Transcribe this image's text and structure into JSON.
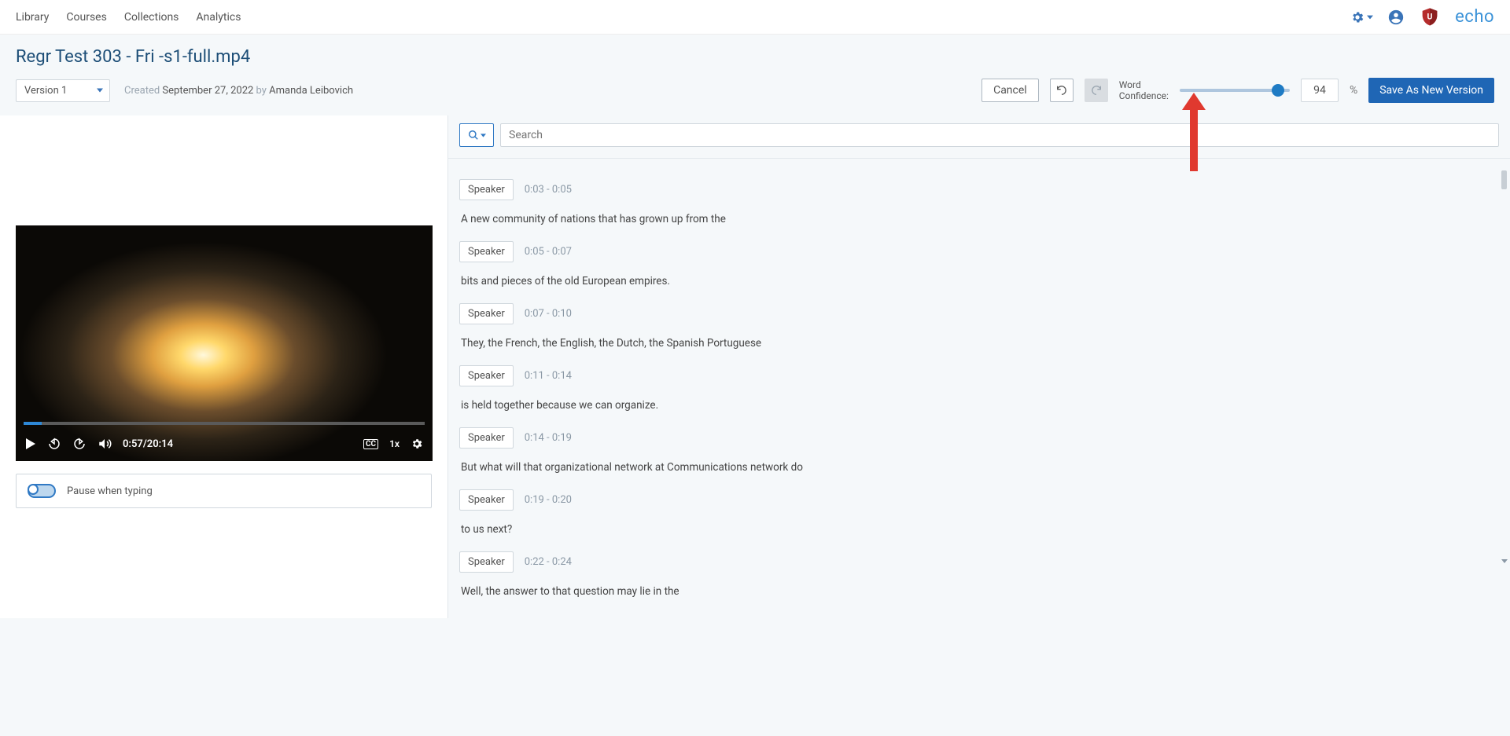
{
  "nav": {
    "items": [
      "Library",
      "Courses",
      "Collections",
      "Analytics"
    ]
  },
  "brand": {
    "echo": "echo"
  },
  "page": {
    "title": "Regr Test 303 - Fri -s1-full.mp4",
    "version_label": "Version 1",
    "created_prefix": "Created ",
    "created_date": "September 27, 2022",
    "created_by": " by ",
    "author": "Amanda Leibovich"
  },
  "toolbar": {
    "cancel": "Cancel",
    "word_confidence": "Word Confidence:",
    "confidence_value": "94",
    "pct": "%",
    "save": "Save As New Version"
  },
  "player": {
    "current_time": "0:57/20:14",
    "speed": "1x",
    "cc": "CC"
  },
  "pause_typing": {
    "label": "Pause when typing"
  },
  "search": {
    "placeholder": "Search"
  },
  "speaker_label": "Speaker",
  "segments": [
    {
      "time": "0:03 - 0:05",
      "text": "A new community of nations that has grown up from the"
    },
    {
      "time": "0:05 - 0:07",
      "text": "bits and pieces of the old European empires."
    },
    {
      "time": "0:07 - 0:10",
      "text": "They, the French, the English, the Dutch, the Spanish Portuguese"
    },
    {
      "time": "0:11 - 0:14",
      "text": "is held together because we can organize."
    },
    {
      "time": "0:14 - 0:19",
      "text": "But what will that organizational network at Communications network do"
    },
    {
      "time": "0:19 - 0:20",
      "text": "to us next?"
    },
    {
      "time": "0:22 - 0:24",
      "text": "Well, the answer to that question may lie in the"
    }
  ]
}
